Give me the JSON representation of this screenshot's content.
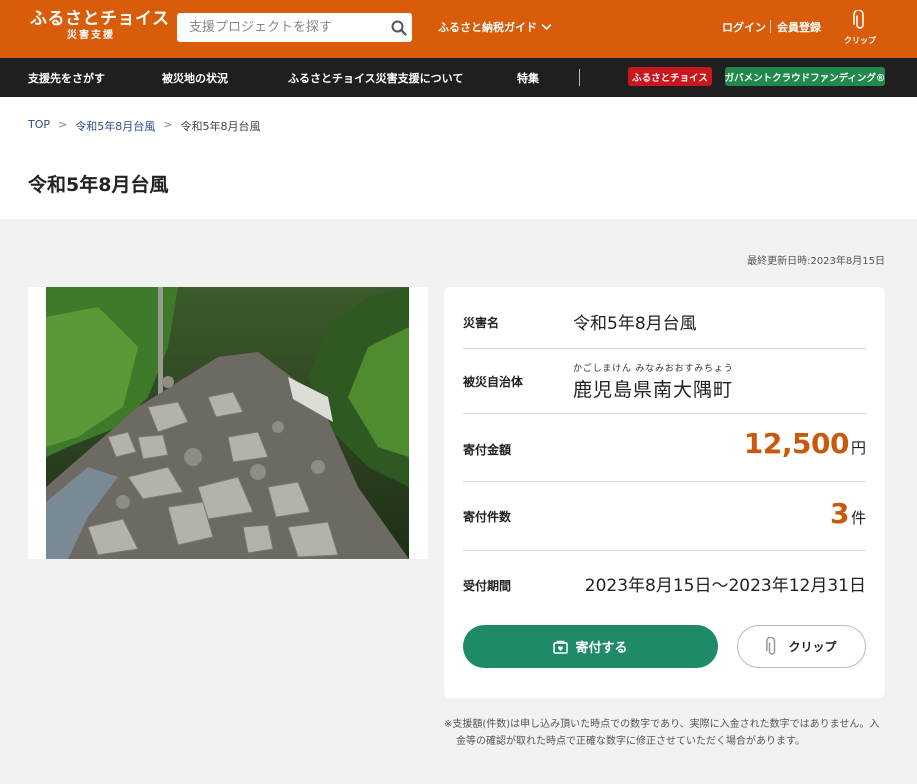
{
  "header": {
    "logo_main": "ふるさとチョイス",
    "logo_sub": "災害支援",
    "search_placeholder": "支援プロジェクトを探す",
    "search_icon": "search-icon",
    "guide_label": "ふるさと納税ガイド",
    "login_label": "ログイン",
    "register_label": "会員登録",
    "clip_label": "クリップ",
    "bg_color": "#d95c0a"
  },
  "nav": {
    "items": [
      "支援先をさがす",
      "被災地の状況",
      "ふるさとチョイス災害支援について",
      "特集"
    ],
    "badge_red": "ふるさとチョイス",
    "badge_green": "ガバメントクラウドファンディング®"
  },
  "breadcrumb": [
    "TOP",
    "令和5年8月台風",
    "令和5年8月台風"
  ],
  "page_title": "令和5年8月台風",
  "last_updated": "最終更新日時:2023年8月15日",
  "info": {
    "disaster_label": "災害名",
    "disaster_value": "令和5年8月台風",
    "municipality_label": "被災自治体",
    "municipality_ruby": "かごしまけん みなみおおすみちょう",
    "municipality_value": "鹿児島県南大隅町",
    "amount_label": "寄付金額",
    "amount_value": "12,500",
    "amount_unit": "円",
    "count_label": "寄付件数",
    "count_value": "3",
    "count_unit": "件",
    "period_label": "受付期間",
    "period_value": "2023年8月15日〜2023年12月31日"
  },
  "actions": {
    "donate_label": "寄付する",
    "clip_label": "クリップ"
  },
  "note": "※支援額(件数)は申し込み頂いた時点での数字であり、実際に入金された数字ではありません。入金等の確認が取れた時点で正確な数字に修正させていただく場合があります。",
  "colors": {
    "accent": "#d95c0a",
    "amount": "#c95a0b",
    "donate_button": "#1e8a68",
    "nav_bg": "#1f1f1f"
  }
}
